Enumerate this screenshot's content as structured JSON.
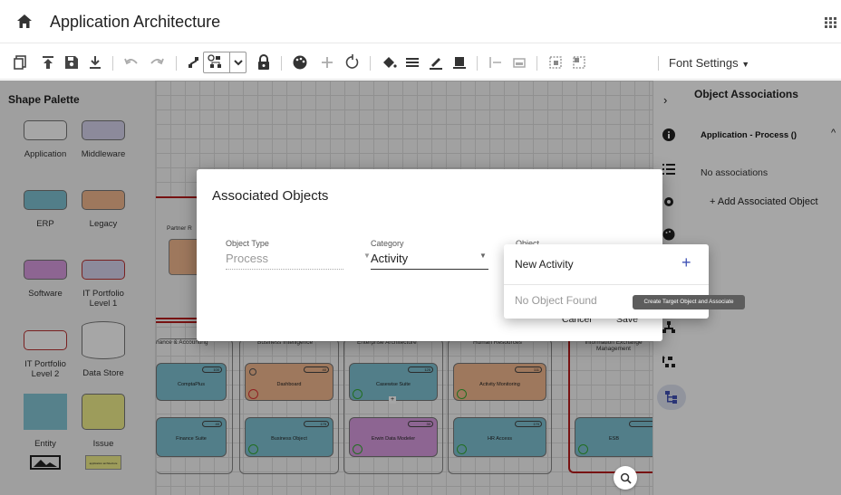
{
  "app": {
    "title": "Application Architecture"
  },
  "toolbar": {
    "font_settings": "Font Settings"
  },
  "palette": {
    "title": "Shape Palette",
    "items": [
      {
        "label": "Application",
        "color": "#ffffff"
      },
      {
        "label": "Middleware",
        "color": "#d7d5ee"
      },
      {
        "label": "ERP",
        "color": "#7fc2d3"
      },
      {
        "label": "Legacy",
        "color": "#f3b88f"
      },
      {
        "label": "Software",
        "color": "#d99be0"
      },
      {
        "label": "IT Portfolio Level 1",
        "color": "#d7d5ee"
      },
      {
        "label": "IT Portfolio Level 2",
        "color": "#ffffff"
      },
      {
        "label": "Data Store",
        "color": "#ffffff"
      },
      {
        "label": "Entity",
        "color": "#84c6d6"
      },
      {
        "label": "Issue",
        "color": "#f1f08c"
      }
    ],
    "thumb_text": "application architecture"
  },
  "canvas": {
    "group_label": "Partner R",
    "columns": [
      "nance & Accounting",
      "Business Intelligence",
      "Enterprise Architecture",
      "Human Resources",
      "Information Exchange Management"
    ],
    "row1": [
      {
        "name": "ComptaPlus",
        "badge": "100"
      },
      {
        "name": "Dashboard",
        "badge": "40"
      },
      {
        "name": "Casewise Suite",
        "badge": "125"
      },
      {
        "name": "Activity Monitoring",
        "badge": "111"
      }
    ],
    "row2": [
      {
        "name": "Finance Suite",
        "badge": "40"
      },
      {
        "name": "Business Object",
        "badge": "175"
      },
      {
        "name": "Erwin Data Modeler",
        "badge": "30"
      },
      {
        "name": "HR Access",
        "badge": "170"
      },
      {
        "name": "ESB",
        "badge": ""
      }
    ]
  },
  "right_panel": {
    "title": "Object Associations",
    "section": "Application - Process ()",
    "empty": "No associations",
    "add": "+ Add Associated Object"
  },
  "modal": {
    "title": "Associated Objects",
    "object_type_label": "Object Type",
    "object_type_value": "Process",
    "category_label": "Category",
    "category_value": "Activity",
    "object_label": "Object",
    "cancel": "Cancel",
    "save": "Save"
  },
  "dropdown": {
    "new_item": "New Activity",
    "no_result": "No Object Found",
    "plus": "+",
    "tooltip": "Create Target Object and Associate"
  },
  "colors": {
    "accent": "#3f51b5",
    "frame_red": "#b71c1c",
    "erp": "#7fc2d3",
    "legacy": "#f3b88f",
    "software": "#d99be0"
  }
}
